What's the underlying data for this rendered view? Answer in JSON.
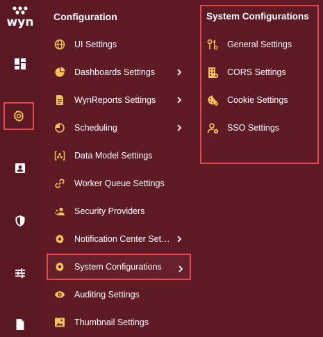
{
  "brand": {
    "logo_text": "wyn"
  },
  "colors": {
    "background": "#5e1a25",
    "accent_icon": "#f6c453",
    "highlight_border": "#e8474d",
    "text": "#ffffff"
  },
  "rail": {
    "items": [
      {
        "icon": "dashboard-grid-icon"
      },
      {
        "icon": "gear-icon",
        "active": true
      },
      {
        "icon": "user-card-icon"
      },
      {
        "icon": "shield-icon"
      },
      {
        "icon": "sliders-icon"
      },
      {
        "icon": "document-icon"
      }
    ]
  },
  "menu": {
    "title": "Configuration",
    "items": [
      {
        "label": "UI Settings",
        "icon": "globe-icon",
        "has_submenu": false
      },
      {
        "label": "Dashboards Settings",
        "icon": "pie-chart-icon",
        "has_submenu": true
      },
      {
        "label": "WynReports Settings",
        "icon": "report-file-icon",
        "has_submenu": true
      },
      {
        "label": "Scheduling",
        "icon": "clock-icon",
        "has_submenu": true
      },
      {
        "label": "Data Model Settings",
        "icon": "data-model-icon",
        "has_submenu": false
      },
      {
        "label": "Worker Queue Settings",
        "icon": "link-icon",
        "has_submenu": false
      },
      {
        "label": "Security Providers",
        "icon": "users-icon",
        "has_submenu": false
      },
      {
        "label": "Notification Center Settings",
        "icon": "gear-icon",
        "has_submenu": true
      },
      {
        "label": "System Configurations",
        "icon": "gear-icon",
        "has_submenu": true,
        "selected": true
      },
      {
        "label": "Auditing Settings",
        "icon": "eye-icon",
        "has_submenu": false
      },
      {
        "label": "Thumbnail Settings",
        "icon": "image-icon",
        "has_submenu": false
      }
    ]
  },
  "submenu": {
    "title": "System Configurations",
    "items": [
      {
        "label": "General Settings",
        "icon": "tools-icon"
      },
      {
        "label": "CORS Settings",
        "icon": "building-icon"
      },
      {
        "label": "Cookie Settings",
        "icon": "cookie-icon"
      },
      {
        "label": "SSO Settings",
        "icon": "user-gear-icon"
      }
    ]
  }
}
